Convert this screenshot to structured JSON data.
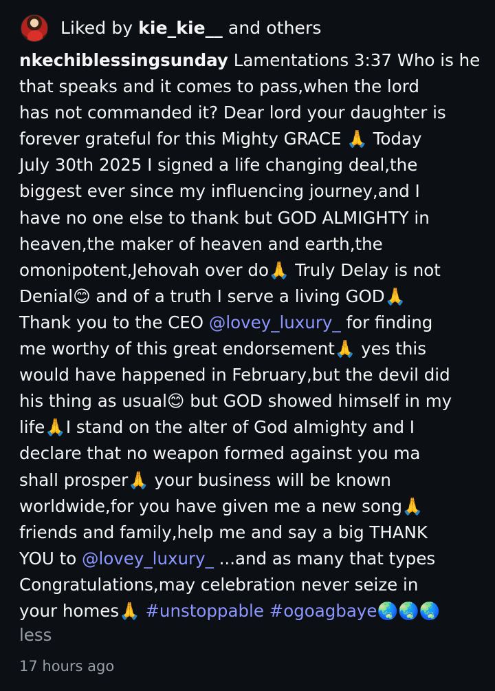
{
  "liked": {
    "prefix": "Liked by ",
    "user": "kie_kie__",
    "suffix": " and others"
  },
  "post": {
    "author": "nkechiblessingsunday",
    "lines": {
      "l1": " Lamentations 3:37 Who is he",
      "l2": "that speaks and it comes to pass,when the lord",
      "l3": "has not commanded it? Dear lord your daughter is",
      "l4": "forever grateful for this Mighty GRACE 🙏 Today",
      "l5": "July 30th 2025 I signed a life changing deal,the",
      "l6": "biggest ever since my influencing journey,and I",
      "l7": "have no one else to thank but GOD ALMIGHTY in",
      "l8": "heaven,the maker of heaven and earth,the",
      "l9": "omonipotent,Jehovah over do🙏 Truly Delay is not",
      "l10": "Denial😊 and of a truth I serve a living GOD🙏",
      "l11a": "Thank you to the CEO ",
      "l11link": "@lovey_luxury_",
      "l11b": " for finding",
      "l12": "me worthy of this great endorsement🙏 yes this",
      "l13": "would have happened in February,but the devil did",
      "l14": "his thing as usual😊 but GOD showed himself in my",
      "l15": "life🙏I stand on the alter of God almighty and I",
      "l16": "declare that no weapon formed against you ma",
      "l17": "shall prosper🙏 your business will be known",
      "l18": "worldwide,for you have given me a new song🙏",
      "l19": "friends and family,help me and say a big THANK",
      "l20a": "YOU to ",
      "l20link": "@lovey_luxury_",
      "l20b": " ...and as many that types",
      "l21": "Congratulations,may celebration never seize in",
      "l22a": "your homes🙏 ",
      "l22tags": "#unstoppable #ogoagbaye",
      "l22b": "🌏🌏🌏"
    },
    "less_label": "less",
    "timestamp": "17 hours ago"
  },
  "colors": {
    "background": "#0c0f14",
    "text": "#f5f5f5",
    "link": "#8c96ff",
    "muted": "#9a9ea6"
  }
}
